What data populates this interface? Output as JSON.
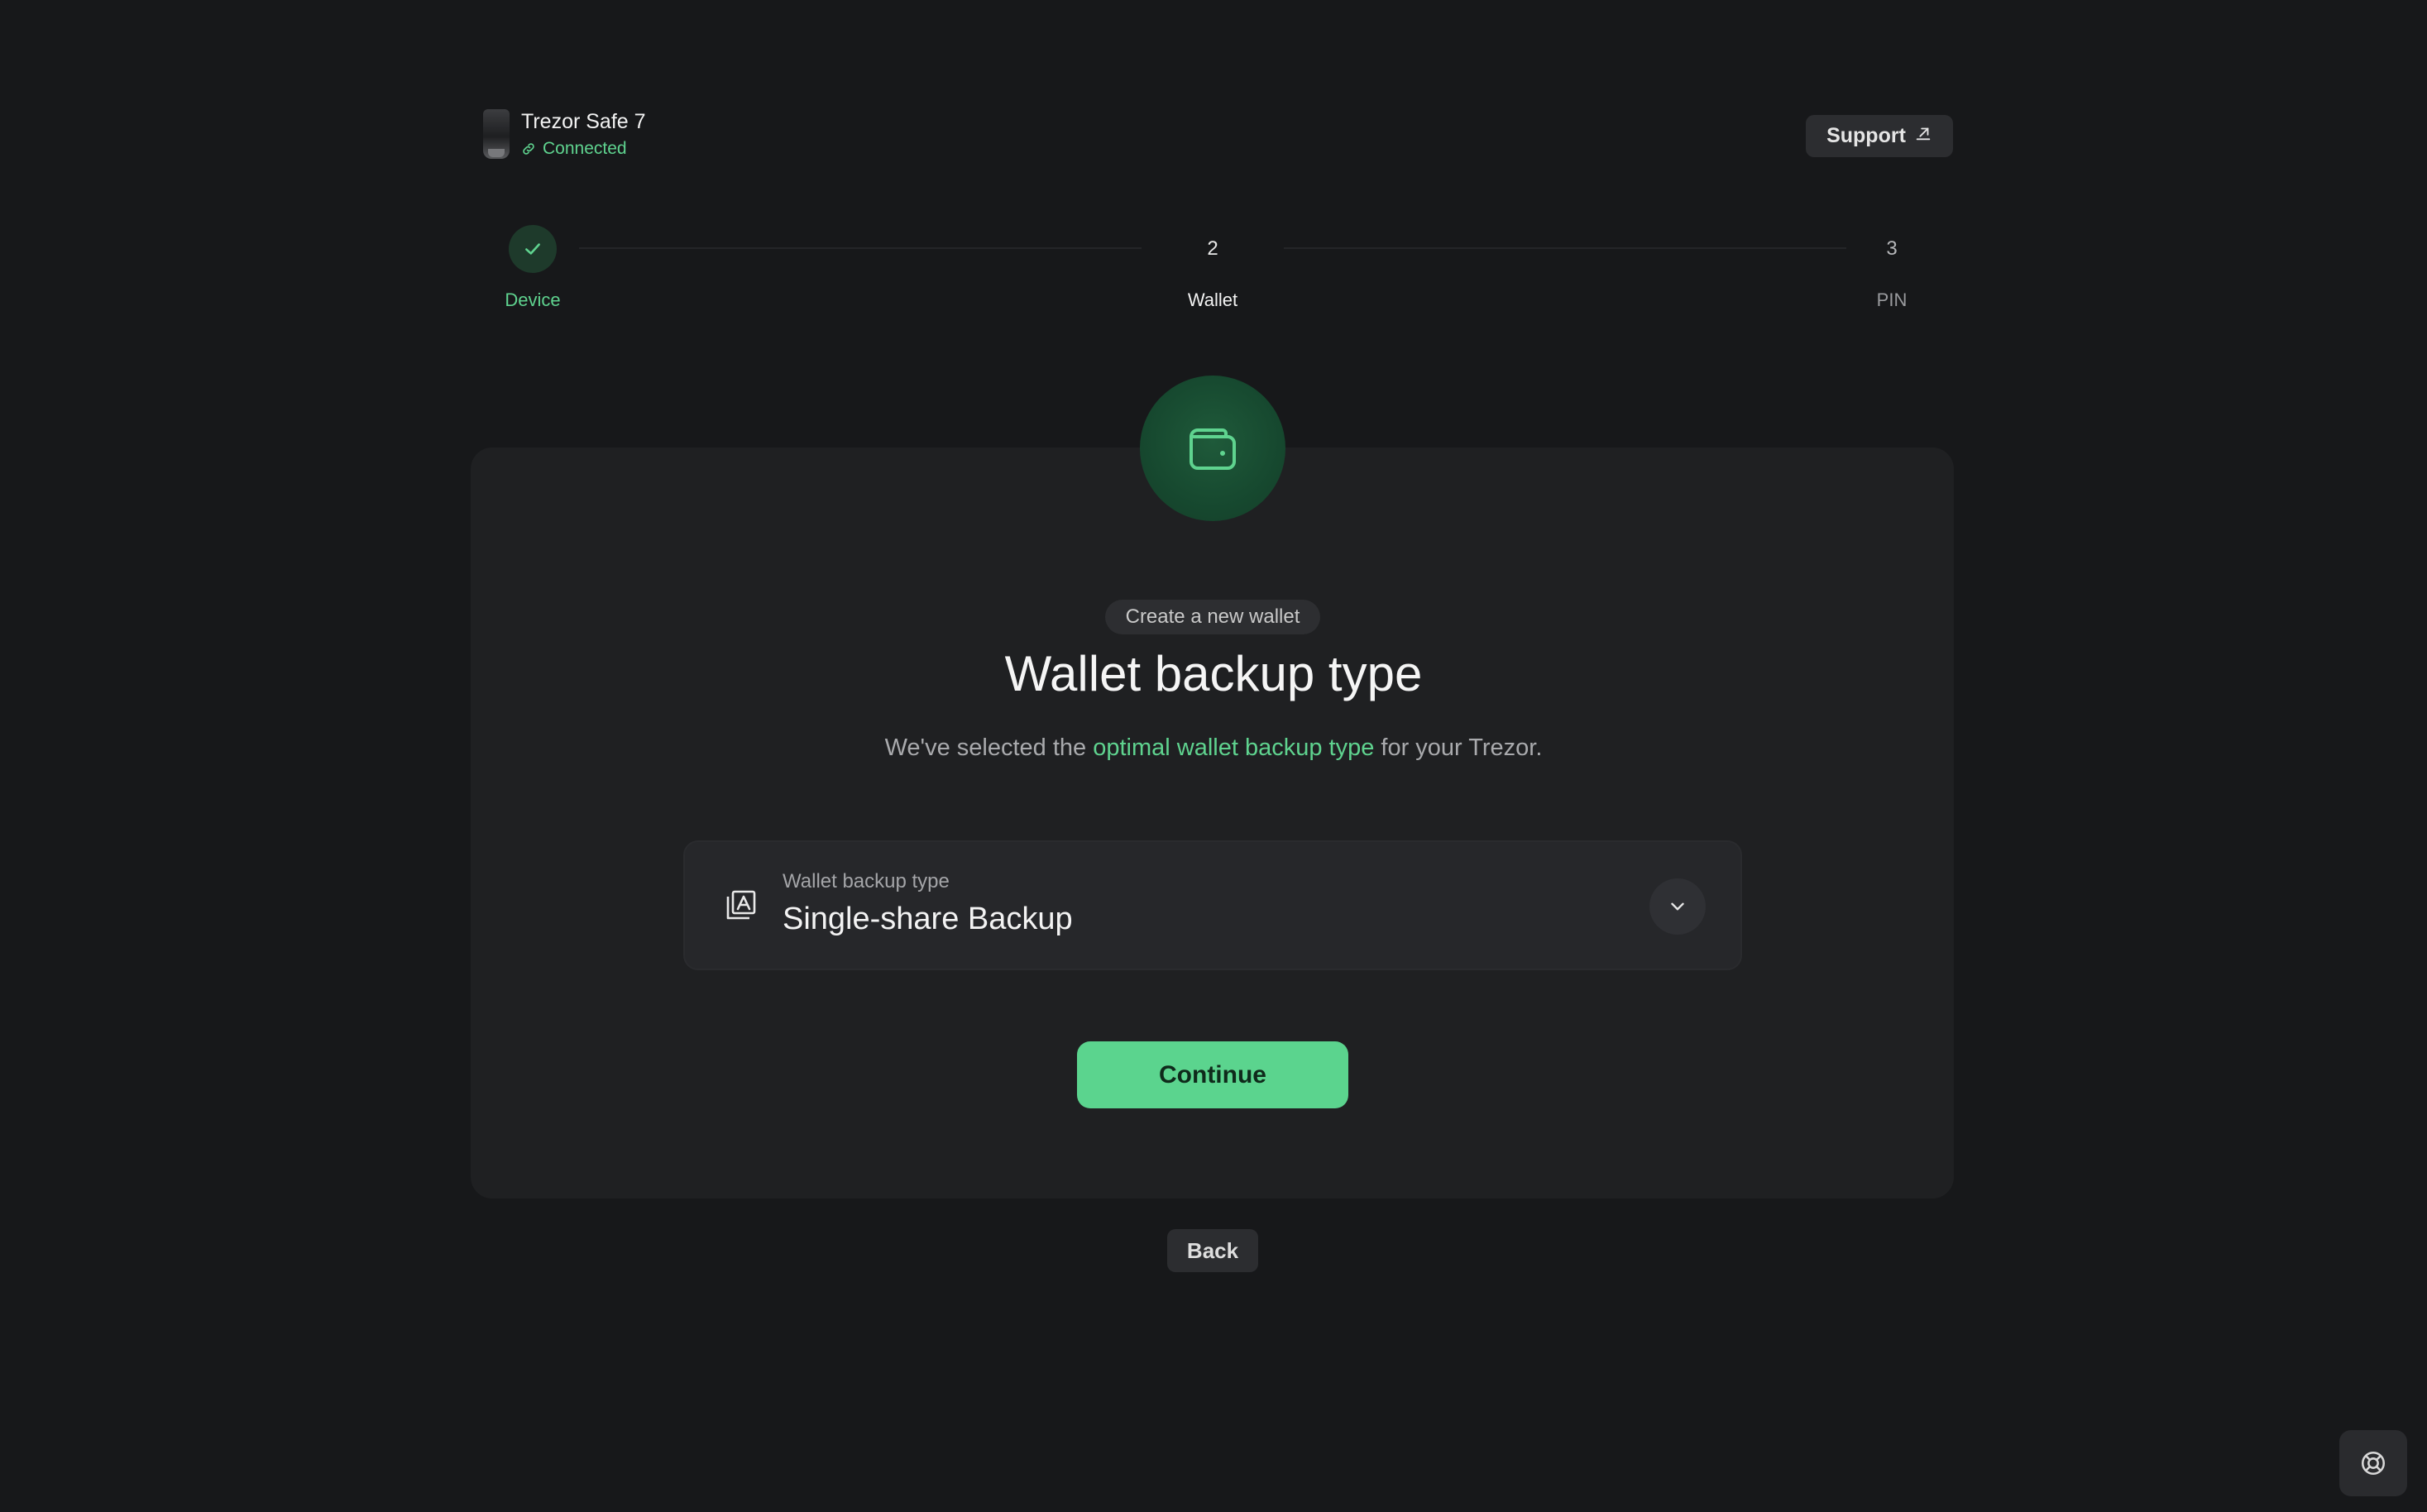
{
  "device": {
    "name": "Trezor Safe 7",
    "status": "Connected"
  },
  "header": {
    "support_label": "Support"
  },
  "stepper": {
    "steps": [
      {
        "number": "1",
        "label": "Device",
        "state": "done"
      },
      {
        "number": "2",
        "label": "Wallet",
        "state": "current"
      },
      {
        "number": "3",
        "label": "PIN",
        "state": "todo"
      }
    ]
  },
  "main": {
    "pill": "Create a new wallet",
    "title": "Wallet backup type",
    "subtitle_before": "We've selected the ",
    "subtitle_link": "optimal wallet backup type",
    "subtitle_after": " for your Trezor.",
    "select": {
      "label": "Wallet backup type",
      "value": "Single-share Backup"
    },
    "continue_label": "Continue",
    "back_label": "Back"
  },
  "icons": {
    "wallet": "wallet-icon",
    "backup": "backup-card-icon",
    "chevron": "chevron-down-icon",
    "external": "external-link-icon",
    "help": "lifebuoy-icon",
    "check": "check-icon",
    "link": "link-icon"
  },
  "colors": {
    "accent": "#5fd38f",
    "button_primary": "#5bd48e",
    "background": "#17181a",
    "card": "#1f2022"
  }
}
